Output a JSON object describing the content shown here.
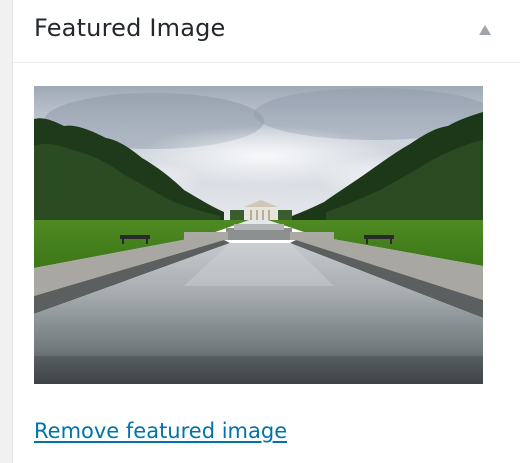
{
  "metabox": {
    "title": "Featured Image",
    "toggle_icon": "triangle-up-icon",
    "image": {
      "subject": "reflecting-pool-photo",
      "alt": "Featured image"
    },
    "remove_label": "Remove featured image",
    "colors": {
      "link": "#0073aa",
      "title": "#23282d",
      "toggle": "#a0a5aa"
    }
  }
}
